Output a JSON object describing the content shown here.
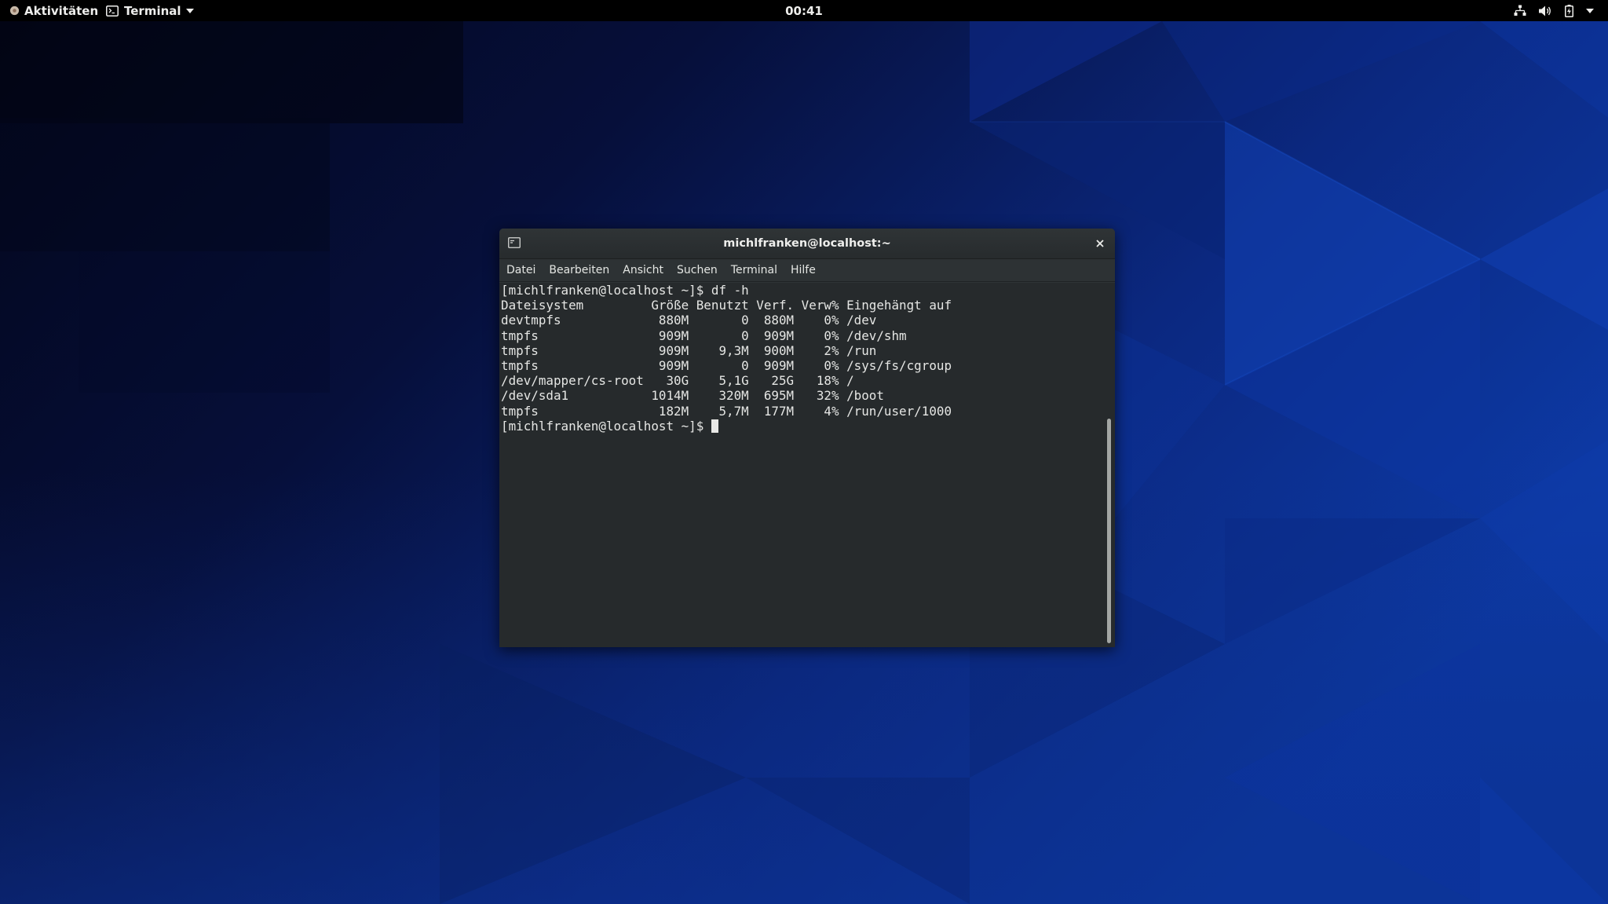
{
  "topbar": {
    "activities_label": "Aktivitäten",
    "app_menu_label": "Terminal",
    "clock": "00:41",
    "tray_icons": [
      "network-icon",
      "volume-icon",
      "battery-icon",
      "system-menu-caret-icon"
    ]
  },
  "window": {
    "title": "michlfranken@localhost:~",
    "menu": [
      "Datei",
      "Bearbeiten",
      "Ansicht",
      "Suchen",
      "Terminal",
      "Hilfe"
    ]
  },
  "terminal": {
    "lines": [
      "[michlfranken@localhost ~]$ df -h",
      "Dateisystem         Größe Benutzt Verf. Verw% Eingehängt auf",
      "devtmpfs             880M       0  880M    0% /dev",
      "tmpfs                909M       0  909M    0% /dev/shm",
      "tmpfs                909M    9,3M  900M    2% /run",
      "tmpfs                909M       0  909M    0% /sys/fs/cgroup",
      "/dev/mapper/cs-root   30G    5,1G   25G   18% /",
      "/dev/sda1           1014M    320M  695M   32% /boot",
      "tmpfs                182M    5,7M  177M    4% /run/user/1000"
    ],
    "prompt": "[michlfranken@localhost ~]$ "
  },
  "colors": {
    "wallpaper_dark": "#050b2a",
    "wallpaper_blue": "#0a2c8a",
    "terminal_bg": "#262a2c",
    "terminal_fg": "#e5e6e4",
    "titlebar_bg": "#2e3436"
  }
}
